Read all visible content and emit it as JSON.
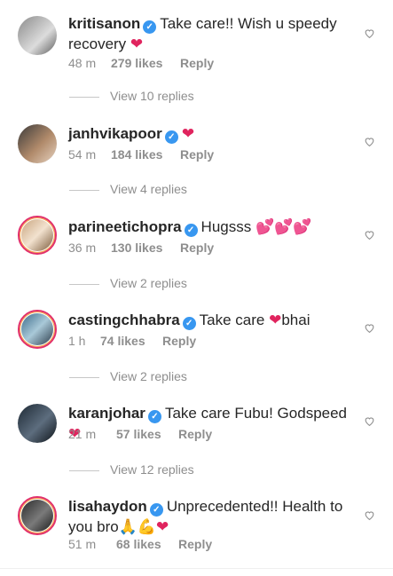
{
  "comments": [
    {
      "username": "kritisanon",
      "text": "Take care!! Wish u speedy recovery",
      "emoji": "❤",
      "time": "48 m",
      "likes": "279 likes",
      "reply": "Reply",
      "view_replies": "View 10 replies"
    },
    {
      "username": "janhvikapoor",
      "text": "",
      "emoji": "❤",
      "time": "54 m",
      "likes": "184 likes",
      "reply": "Reply",
      "view_replies": "View 4 replies"
    },
    {
      "username": "parineetichopra",
      "text": "Hugsss",
      "emoji": "💕💕💕",
      "time": "36 m",
      "likes": "130 likes",
      "reply": "Reply",
      "view_replies": "View 2 replies"
    },
    {
      "username": "castingchhabra",
      "text": "Take care",
      "emoji": "❤",
      "text2": "bhai",
      "time": "1 h",
      "likes": "74 likes",
      "reply": "Reply",
      "view_replies": "View 2 replies"
    },
    {
      "username": "karanjohar",
      "text": "Take care Fubu! Godspeed",
      "emoji": "❤",
      "time": "21 m",
      "likes": "57 likes",
      "reply": "Reply",
      "view_replies": "View 12 replies"
    },
    {
      "username": "lisahaydon",
      "text": "Unprecedented!! Health to you bro",
      "emoji": "🙏💪❤",
      "time": "51 m",
      "likes": "68 likes",
      "reply": "Reply"
    }
  ],
  "icons": {
    "verified": "verified-badge-icon",
    "like": "heart-outline-icon"
  },
  "colors": {
    "verified": "#3897f0",
    "meta": "#8e8e8e",
    "ring": "#e1306c"
  }
}
